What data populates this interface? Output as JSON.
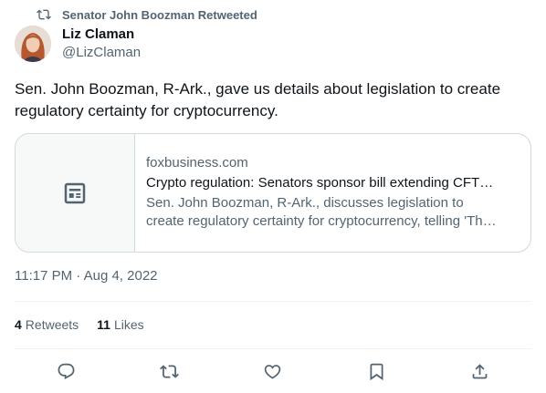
{
  "retweet_context": {
    "label": "Senator John Boozman Retweeted",
    "icon": "retweet-icon"
  },
  "author": {
    "name": "Liz Claman",
    "handle": "@LizClaman"
  },
  "tweet": {
    "text": "Sen. John Boozman, R-Ark., gave us details about legislation to create regulatory certainty for cryptocurrency.",
    "time": "11:17 PM",
    "separator": " · ",
    "date": "Aug 4, 2022"
  },
  "link_card": {
    "domain": "foxbusiness.com",
    "title": "Crypto regulation: Senators sponsor bill extending CFTC's ...",
    "description": "Sen. John Boozman, R-Ark., discusses legislation to create regulatory certainty for cryptocurrency, telling 'The Clama...",
    "thumbnail_icon": "article-icon"
  },
  "stats": [
    {
      "count": "4",
      "label": "Retweets"
    },
    {
      "count": "11",
      "label": "Likes"
    }
  ],
  "actions": [
    "reply-icon",
    "retweet-icon",
    "like-icon",
    "bookmark-icon",
    "share-icon"
  ],
  "colors": {
    "text": "#0f1419",
    "secondary": "#536471",
    "border": "#cfd9de",
    "divider": "#eff3f4"
  }
}
